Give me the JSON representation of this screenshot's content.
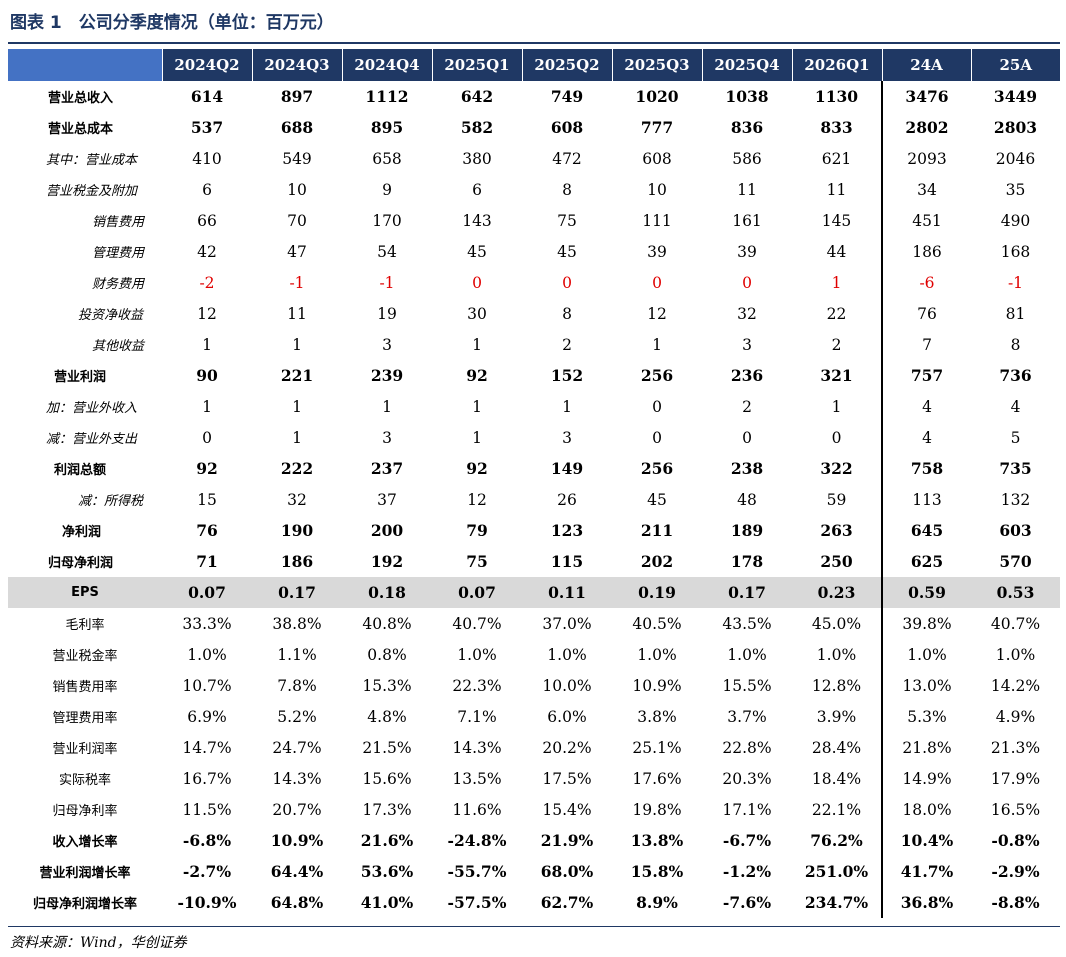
{
  "title": "图表 1　公司分季度情况（单位：百万元）",
  "columns": [
    "2024Q2",
    "2024Q3",
    "2024Q4",
    "2025Q1",
    "2025Q2",
    "2025Q3",
    "2025Q4",
    "2026Q1",
    "24A",
    "25A"
  ],
  "rows": [
    {
      "label": "营业总收入",
      "style": "bold",
      "values": [
        "614",
        "897",
        "1112",
        "642",
        "749",
        "1020",
        "1038",
        "1130",
        "3476",
        "3449"
      ]
    },
    {
      "label": "营业总成本",
      "style": "bold",
      "values": [
        "537",
        "688",
        "895",
        "582",
        "608",
        "777",
        "836",
        "833",
        "2802",
        "2803"
      ]
    },
    {
      "label": "其中：营业成本",
      "style": "ital",
      "indent": 0,
      "values": [
        "410",
        "549",
        "658",
        "380",
        "472",
        "608",
        "586",
        "621",
        "2093",
        "2046"
      ]
    },
    {
      "label": "营业税金及附加",
      "style": "ital",
      "values": [
        "6",
        "10",
        "9",
        "6",
        "8",
        "10",
        "11",
        "11",
        "34",
        "35"
      ]
    },
    {
      "label": "销售费用",
      "style": "ital",
      "values": [
        "66",
        "70",
        "170",
        "143",
        "75",
        "111",
        "161",
        "145",
        "451",
        "490"
      ]
    },
    {
      "label": "管理费用",
      "style": "ital",
      "values": [
        "42",
        "47",
        "54",
        "45",
        "45",
        "39",
        "39",
        "44",
        "186",
        "168"
      ]
    },
    {
      "label": "财务费用",
      "style": "ital red",
      "values": [
        "-2",
        "-1",
        "-1",
        "0",
        "0",
        "0",
        "0",
        "1",
        "-6",
        "-1"
      ]
    },
    {
      "label": "投资净收益",
      "style": "ital",
      "values": [
        "12",
        "11",
        "19",
        "30",
        "8",
        "12",
        "32",
        "22",
        "76",
        "81"
      ]
    },
    {
      "label": "其他收益",
      "style": "ital",
      "values": [
        "1",
        "1",
        "3",
        "1",
        "2",
        "1",
        "3",
        "2",
        "7",
        "8"
      ]
    },
    {
      "label": "营业利润",
      "style": "bold",
      "values": [
        "90",
        "221",
        "239",
        "92",
        "152",
        "256",
        "236",
        "321",
        "757",
        "736"
      ]
    },
    {
      "label": "加：营业外收入",
      "style": "ital",
      "values": [
        "1",
        "1",
        "1",
        "1",
        "1",
        "0",
        "2",
        "1",
        "4",
        "4"
      ]
    },
    {
      "label": "减：营业外支出",
      "style": "ital",
      "values": [
        "0",
        "1",
        "3",
        "1",
        "3",
        "0",
        "0",
        "0",
        "4",
        "5"
      ]
    },
    {
      "label": "利润总额",
      "style": "bold",
      "values": [
        "92",
        "222",
        "237",
        "92",
        "149",
        "256",
        "238",
        "322",
        "758",
        "735"
      ]
    },
    {
      "label": "减：所得税",
      "style": "ital",
      "values": [
        "15",
        "32",
        "37",
        "12",
        "26",
        "45",
        "48",
        "59",
        "113",
        "132"
      ]
    },
    {
      "label": "净利润",
      "style": "bold",
      "values": [
        "76",
        "190",
        "200",
        "79",
        "123",
        "211",
        "189",
        "263",
        "645",
        "603"
      ]
    },
    {
      "label": "归母净利润",
      "style": "bold",
      "values": [
        "71",
        "186",
        "192",
        "75",
        "115",
        "202",
        "178",
        "250",
        "625",
        "570"
      ]
    },
    {
      "label": "EPS",
      "style": "bold eps",
      "values": [
        "0.07",
        "0.17",
        "0.18",
        "0.07",
        "0.11",
        "0.19",
        "0.17",
        "0.23",
        "0.59",
        "0.53"
      ]
    },
    {
      "label": "毛利率",
      "style": "",
      "values": [
        "33.3%",
        "38.8%",
        "40.8%",
        "40.7%",
        "37.0%",
        "40.5%",
        "43.5%",
        "45.0%",
        "39.8%",
        "40.7%"
      ]
    },
    {
      "label": "营业税金率",
      "style": "",
      "values": [
        "1.0%",
        "1.1%",
        "0.8%",
        "1.0%",
        "1.0%",
        "1.0%",
        "1.0%",
        "1.0%",
        "1.0%",
        "1.0%"
      ]
    },
    {
      "label": "销售费用率",
      "style": "",
      "values": [
        "10.7%",
        "7.8%",
        "15.3%",
        "22.3%",
        "10.0%",
        "10.9%",
        "15.5%",
        "12.8%",
        "13.0%",
        "14.2%"
      ]
    },
    {
      "label": "管理费用率",
      "style": "",
      "values": [
        "6.9%",
        "5.2%",
        "4.8%",
        "7.1%",
        "6.0%",
        "3.8%",
        "3.7%",
        "3.9%",
        "5.3%",
        "4.9%"
      ]
    },
    {
      "label": "营业利润率",
      "style": "",
      "values": [
        "14.7%",
        "24.7%",
        "21.5%",
        "14.3%",
        "20.2%",
        "25.1%",
        "22.8%",
        "28.4%",
        "21.8%",
        "21.3%"
      ]
    },
    {
      "label": "实际税率",
      "style": "",
      "values": [
        "16.7%",
        "14.3%",
        "15.6%",
        "13.5%",
        "17.5%",
        "17.6%",
        "20.3%",
        "18.4%",
        "14.9%",
        "17.9%"
      ]
    },
    {
      "label": "归母净利率",
      "style": "",
      "values": [
        "11.5%",
        "20.7%",
        "17.3%",
        "11.6%",
        "15.4%",
        "19.8%",
        "17.1%",
        "22.1%",
        "18.0%",
        "16.5%"
      ]
    },
    {
      "label": "收入增长率",
      "style": "bold",
      "values": [
        "-6.8%",
        "10.9%",
        "21.6%",
        "-24.8%",
        "21.9%",
        "13.8%",
        "-6.7%",
        "76.2%",
        "10.4%",
        "-0.8%"
      ]
    },
    {
      "label": "营业利润增长率",
      "style": "bold",
      "values": [
        "-2.7%",
        "64.4%",
        "53.6%",
        "-55.7%",
        "68.0%",
        "15.8%",
        "-1.2%",
        "251.0%",
        "41.7%",
        "-2.9%"
      ]
    },
    {
      "label": "归母净利润增长率",
      "style": "bold",
      "values": [
        "-10.9%",
        "64.8%",
        "41.0%",
        "-57.5%",
        "62.7%",
        "8.9%",
        "-7.6%",
        "234.7%",
        "36.8%",
        "-8.8%"
      ]
    }
  ],
  "source": "资料来源：Wind，华创证券"
}
